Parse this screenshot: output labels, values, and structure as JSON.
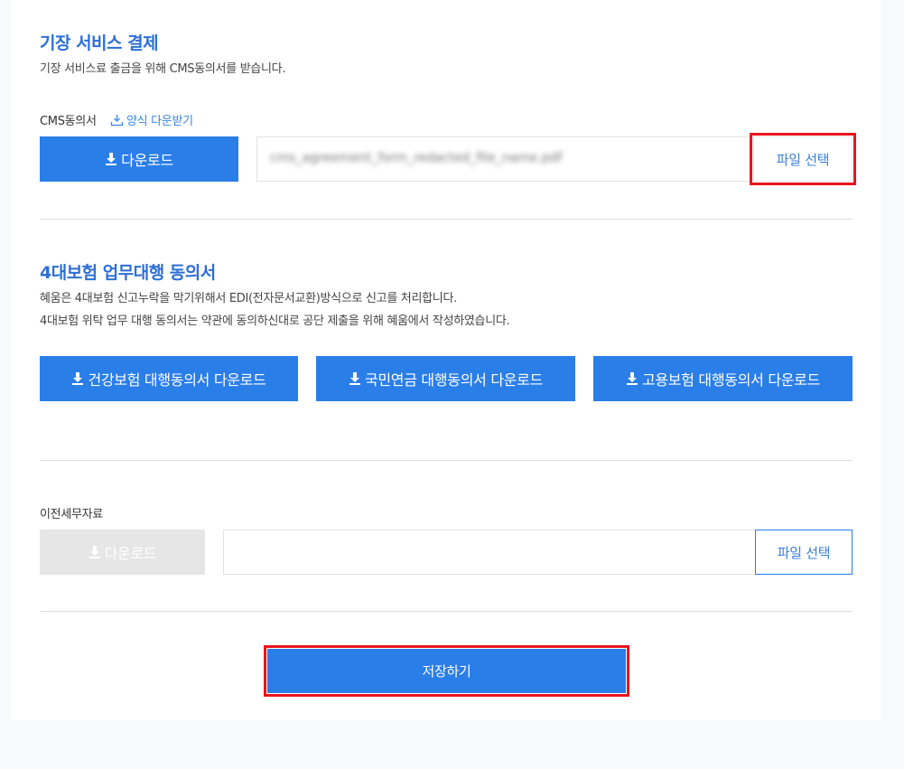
{
  "cms_section": {
    "title": "기장 서비스 결제",
    "description": "기장 서비스료 출금을 위해 CMS동의서를 받습니다.",
    "field_label": "CMS동의서",
    "form_link_label": "양식 다운받기",
    "download_label": "다운로드",
    "file_name": "cms_agreement_form_redacted_file_name.pdf",
    "file_select_label": "파일 선택"
  },
  "insurance_section": {
    "title": "4대보험 업무대행 동의서",
    "description_lines": [
      "혜움은 4대보험 신고누락을 막기위해서 EDI(전자문서교환)방식으로 신고를 처리합니다.",
      "4대보험 위탁 업무 대행 동의서는 약관에 동의하신대로 공단 제출을 위해 혜움에서 작성하였습니다."
    ],
    "buttons": [
      {
        "label": "건강보험 대행동의서 다운로드"
      },
      {
        "label": "국민연금 대행동의서 다운로드"
      },
      {
        "label": "고용보험 대행동의서 다운로드"
      }
    ]
  },
  "prev_tax_section": {
    "field_label": "이전세무자료",
    "download_label": "다운로드",
    "file_select_label": "파일 선택"
  },
  "save_label": "저장하기",
  "colors": {
    "accent": "#2a7ee8",
    "title": "#2d6fd6",
    "highlight": "#e8141e",
    "disabled": "#e6e6e6"
  }
}
